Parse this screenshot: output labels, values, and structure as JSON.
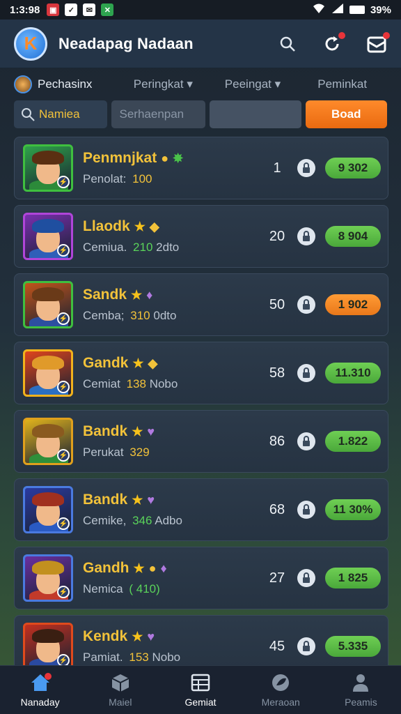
{
  "status": {
    "time": "1:3:98",
    "battery": "39%"
  },
  "header": {
    "title": "Neadapag Nadaan",
    "logo_glyph": "K"
  },
  "tabs": [
    {
      "label": "Pechasinx"
    },
    {
      "label": "Peringkat"
    },
    {
      "label": "Peeingat"
    },
    {
      "label": "Peminkat"
    }
  ],
  "filters": {
    "search_value": "Namiea",
    "filter1": "Serhaenpan",
    "filter2": "",
    "button": "Boad"
  },
  "rows": [
    {
      "name": "Penmnjkat",
      "sub_label": "Penolat:",
      "sub_value": "100",
      "sub_extra": "",
      "rank": "1",
      "score": "9 302",
      "score_color": "green",
      "frame": "#3fbf3f",
      "bg": "#2fa34a",
      "hair": "#5a2f12",
      "body": "#2c8a3a",
      "hl_color": "#f2c23a",
      "badges": [
        "gold-coin",
        "green-gem"
      ]
    },
    {
      "name": "Llaodk",
      "sub_label": "Cemiua.",
      "sub_value": "210",
      "sub_extra": "2dto",
      "rank": "20",
      "score": "8 904",
      "score_color": "green",
      "frame": "#b045d9",
      "bg": "#7a2fae",
      "hair": "#1f4fa0",
      "body": "#2f5fb8",
      "hl_color": "#5ad35a",
      "badges": [
        "star",
        "gold-gem"
      ]
    },
    {
      "name": "Sandk",
      "sub_label": "Cemba;",
      "sub_value": "310",
      "sub_extra": "0dto",
      "rank": "50",
      "score": "1 902",
      "score_color": "orange",
      "frame": "#3fbf3f",
      "bg": "#c2541a",
      "hair": "#6a3a18",
      "body": "#2d4fa0",
      "hl_color": "#f2c23a",
      "badges": [
        "star",
        "purple-gem"
      ]
    },
    {
      "name": "Gandk",
      "sub_label": "Cemiat",
      "sub_value": "138",
      "sub_extra": "Nobo",
      "rank": "58",
      "score": "11.310",
      "score_color": "green",
      "frame": "#f2b21c",
      "bg": "#e0441c",
      "hair": "#e09a2a",
      "body": "#2a6fc2",
      "hl_color": "#f2c23a",
      "badges": [
        "star",
        "gold-gem"
      ]
    },
    {
      "name": "Bandk",
      "sub_label": "Perukat",
      "sub_value": "329",
      "sub_extra": "",
      "rank": "86",
      "score": "1.822",
      "score_color": "green",
      "frame": "#e0a01c",
      "bg": "#e0b21c",
      "hair": "#8a5a1f",
      "body": "#2f8f3a",
      "hl_color": "#f2c23a",
      "badges": [
        "star",
        "purple-heart"
      ]
    },
    {
      "name": "Bandk",
      "sub_label": "Cemike,",
      "sub_value": "346",
      "sub_extra": "Adbo",
      "rank": "68",
      "score": "11 30%",
      "score_color": "green",
      "frame": "#4a7ae0",
      "bg": "#2a3aa0",
      "hair": "#a0301f",
      "body": "#2a5ac2",
      "hl_color": "#5ad35a",
      "badges": [
        "star",
        "purple-heart"
      ]
    },
    {
      "name": "Gandh",
      "sub_label": "Nemica",
      "sub_value": "( 410)",
      "sub_extra": "",
      "rank": "27",
      "score": "1 825",
      "score_color": "green",
      "frame": "#4a7ae0",
      "bg": "#6a2fa0",
      "hair": "#c2901f",
      "body": "#c23a2a",
      "hl_color": "#5ad35a",
      "badges": [
        "star",
        "gold-coin",
        "purple-gem"
      ]
    },
    {
      "name": "Kendk",
      "sub_label": "Pamiat.",
      "sub_value": "153",
      "sub_extra": "Nobo",
      "rank": "45",
      "score": "5.335",
      "score_color": "green",
      "frame": "#e04a1c",
      "bg": "#c2301f",
      "hair": "#3a1f12",
      "body": "#2a4aa0",
      "hl_color": "#f2c23a",
      "badges": [
        "star",
        "purple-heart"
      ]
    }
  ],
  "nav": [
    {
      "label": "Nanaday",
      "icon": "home-icon",
      "active": true
    },
    {
      "label": "Maiel",
      "icon": "cube-icon",
      "active": false
    },
    {
      "label": "Gemiat",
      "icon": "grid-icon",
      "active": true
    },
    {
      "label": "Meraoan",
      "icon": "leaf-icon",
      "active": false
    },
    {
      "label": "Peamis",
      "icon": "user-icon",
      "active": false
    }
  ]
}
